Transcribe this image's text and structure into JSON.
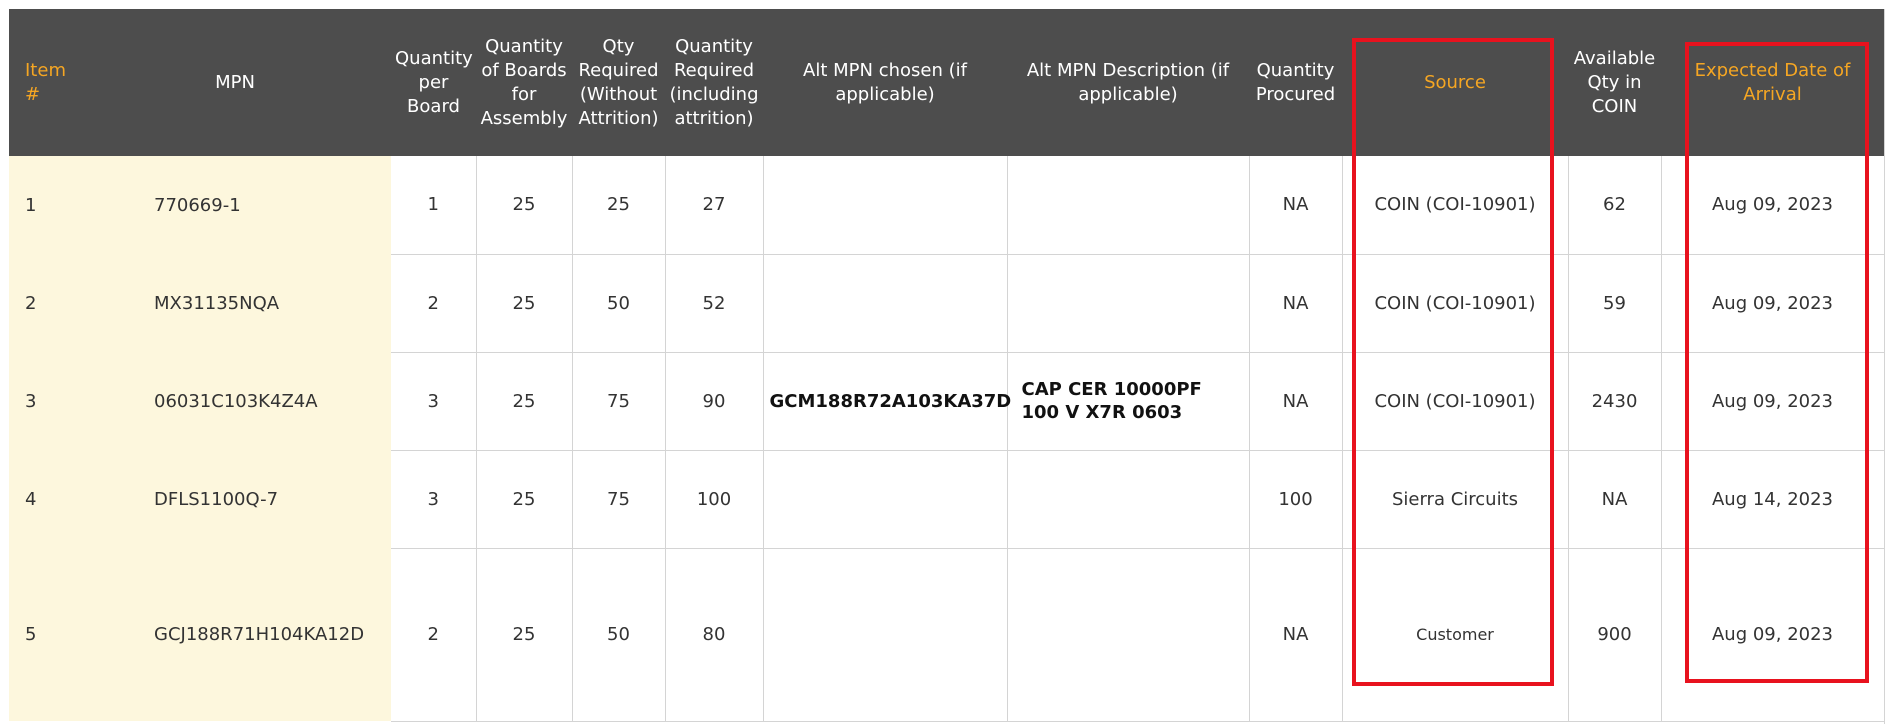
{
  "columns": [
    {
      "key": "item",
      "label": "Item #",
      "highlight": true
    },
    {
      "key": "mpn",
      "label": "MPN",
      "highlight": false
    },
    {
      "key": "qty_per_board",
      "label": "Quantity per Board",
      "highlight": false
    },
    {
      "key": "qty_boards",
      "label": "Quantity of Boards for Assembly",
      "highlight": false
    },
    {
      "key": "qty_req_without",
      "label": "Qty Required (Without Attrition)",
      "highlight": false
    },
    {
      "key": "qty_req_including",
      "label": "Quantity Required (including attrition)",
      "highlight": false
    },
    {
      "key": "alt_mpn",
      "label": "Alt MPN chosen (if applicable)",
      "highlight": false
    },
    {
      "key": "alt_desc",
      "label": "Alt MPN Description (if applicable)",
      "highlight": false
    },
    {
      "key": "qty_procured",
      "label": "Quantity Procured",
      "highlight": false
    },
    {
      "key": "source",
      "label": "Source",
      "highlight": true
    },
    {
      "key": "avail_coin",
      "label": "Available Qty in COIN",
      "highlight": false
    },
    {
      "key": "eta",
      "label": "Expected Date of Arrival",
      "highlight": true
    }
  ],
  "rows": [
    {
      "item": "1",
      "mpn": "770669-1",
      "qty_per_board": "1",
      "qty_boards": "25",
      "qty_req_without": "25",
      "qty_req_including": "27",
      "alt_mpn": "",
      "alt_desc": "",
      "qty_procured": "NA",
      "source": "COIN (COI-10901)",
      "avail_coin": "62",
      "eta": "Aug 09, 2023"
    },
    {
      "item": "2",
      "mpn": "MX31135NQA",
      "qty_per_board": "2",
      "qty_boards": "25",
      "qty_req_without": "50",
      "qty_req_including": "52",
      "alt_mpn": "",
      "alt_desc": "",
      "qty_procured": "NA",
      "source": "COIN (COI-10901)",
      "avail_coin": "59",
      "eta": "Aug 09, 2023"
    },
    {
      "item": "3",
      "mpn": "06031C103K4Z4A",
      "qty_per_board": "3",
      "qty_boards": "25",
      "qty_req_without": "75",
      "qty_req_including": "90",
      "alt_mpn": "GCM188R72A103KA37D",
      "alt_desc": "CAP CER 10000PF 100 V X7R 0603",
      "qty_procured": "NA",
      "source": "COIN (COI-10901)",
      "avail_coin": "2430",
      "eta": "Aug 09, 2023"
    },
    {
      "item": "4",
      "mpn": "DFLS1100Q-7",
      "qty_per_board": "3",
      "qty_boards": "25",
      "qty_req_without": "75",
      "qty_req_including": "100",
      "alt_mpn": "",
      "alt_desc": "",
      "qty_procured": "100",
      "source": "Sierra Circuits",
      "avail_coin": "NA",
      "eta": "Aug 14, 2023"
    },
    {
      "item": "5",
      "mpn": "GCJ188R71H104KA12D",
      "qty_per_board": "2",
      "qty_boards": "25",
      "qty_req_without": "50",
      "qty_req_including": "80",
      "alt_mpn": "",
      "alt_desc": "",
      "qty_procured": "NA",
      "source": "Customer",
      "avail_coin": "900",
      "eta": "Aug 09, 2023"
    }
  ],
  "colors": {
    "header_bg": "#4d4d4d",
    "header_text": "#ffffff",
    "header_highlight_text": "#f5a623",
    "item_mpn_bg": "#fdf7dd",
    "highlight_box": "#e8121e"
  }
}
